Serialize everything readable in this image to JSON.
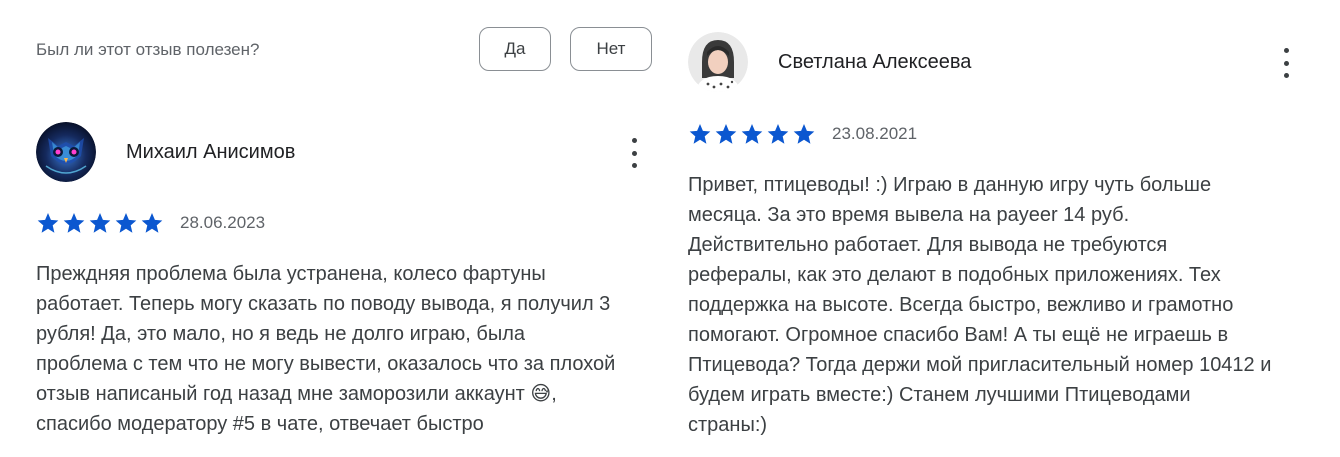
{
  "helpful": {
    "question": "Был ли этот отзыв полезен?",
    "yes_label": "Да",
    "no_label": "Нет"
  },
  "reviews": [
    {
      "author": "Михаил Анисимов",
      "avatar_icon": "owl-avatar",
      "rating": 5,
      "date": "28.06.2023",
      "text": "Преждняя проблема была устранена, колесо фартуны\nработает. Теперь могу сказать по поводу вывода, я получил 3\nрубля! Да, это мало, но я ведь не долго играю, была\nпроблема с тем что не могу вывести, оказалось что за плохой\nотзыв написаный год назад мне заморозили аккаунт 😅,\nспасибо модератору #5 в чате, отвечает быстро"
    },
    {
      "author": "Светлана Алексеева",
      "avatar_icon": "user-photo-avatar",
      "rating": 5,
      "date": "23.08.2021",
      "text": "Привет, птицеводы! :) Играю в данную игру чуть больше\nмесяца. За это время вывела на payeer 14 руб.\nДействительно работает. Для вывода не требуются\nрефералы, как это делают в подобных приложениях. Тех\nподдержка на высоте. Всегда быстро, вежливо и грамотно\nпомогают. Огромное спасибо Вам! А ты ещё не играешь в\nПтицевода? Тогда держи мой пригласительный номер 10412 и\nбудем играть вместе:) Станем лучшими Птицеводами\nстраны:)"
    }
  ],
  "colors": {
    "star": "#0b57d0",
    "text": "#3c4043",
    "muted": "#5f6368"
  }
}
